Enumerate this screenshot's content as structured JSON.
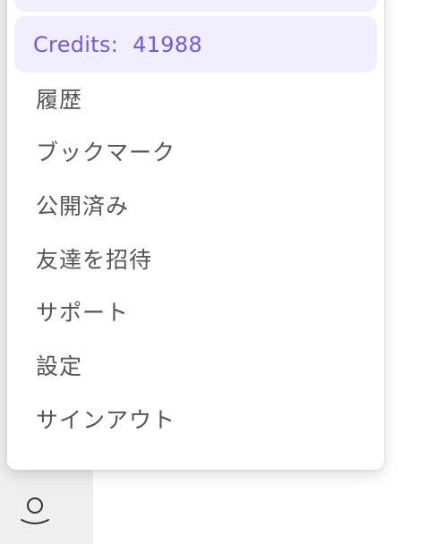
{
  "menu": {
    "credits_label": "Credits:",
    "credits_value": "41988",
    "items": [
      {
        "label": "履歴"
      },
      {
        "label": "ブックマーク"
      },
      {
        "label": "公開済み"
      },
      {
        "label": "友達を招待"
      },
      {
        "label": "サポート"
      },
      {
        "label": "設定"
      },
      {
        "label": "サインアウト"
      }
    ]
  },
  "colors": {
    "accent": "#6f5be6",
    "highlight_bg": "#f1efff",
    "text": "#555555",
    "sidebar_bg": "#efefef"
  },
  "icons": {
    "profile": "user-icon"
  }
}
